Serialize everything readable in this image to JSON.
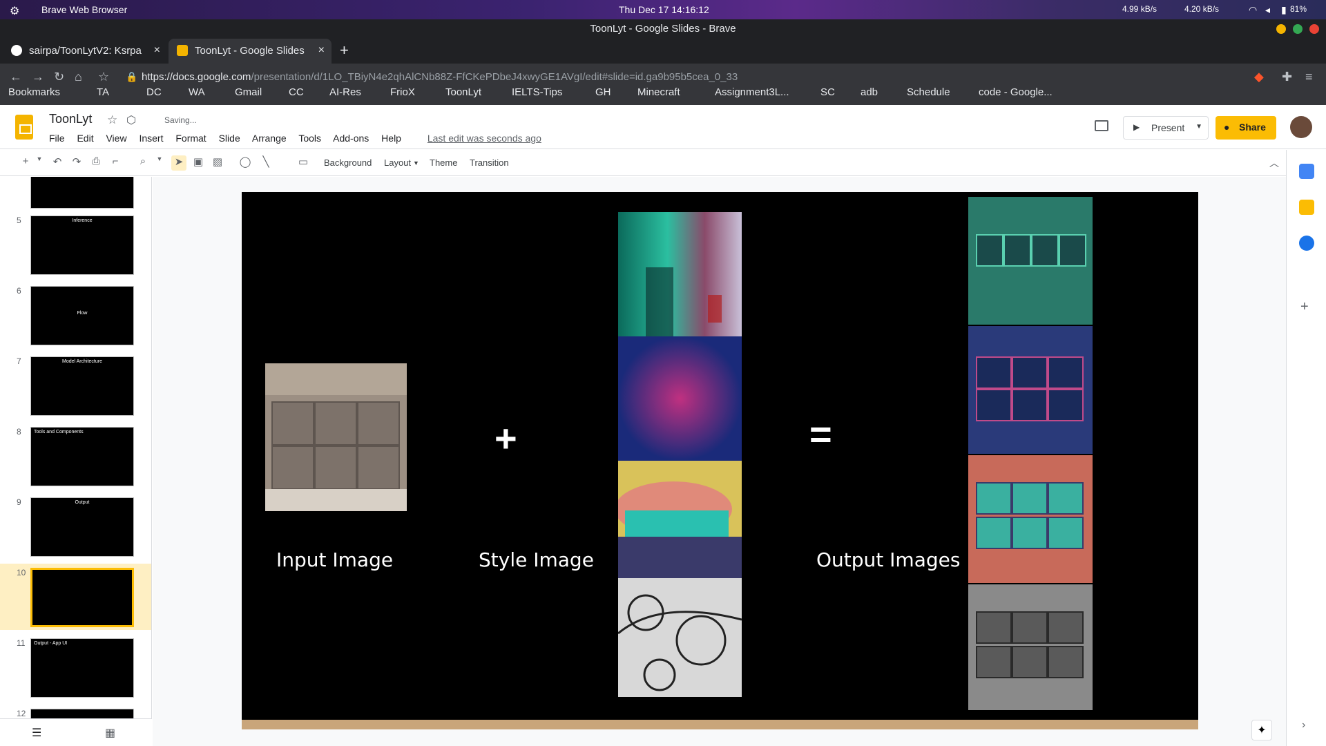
{
  "os_bar": {
    "app": "Brave Web Browser",
    "datetime": "Thu Dec 17  14:16:12",
    "upload": "4.99 kB/s",
    "download": "4.20 kB/s",
    "battery": "81%"
  },
  "window_title": "ToonLyt - Google Slides - Brave",
  "tabs": [
    {
      "label": "sairpa/ToonLytV2: Ksrpa",
      "close": "×"
    },
    {
      "label": "ToonLyt - Google Slides",
      "close": "×"
    }
  ],
  "new_tab": "+",
  "url": {
    "prefix": "https://",
    "domain": "docs.google.com",
    "path": "/presentation/d/1LO_TBiyN4e2qhAlCNb88Z-FfCKePDbeJ4xwyGE1AVgI/edit#slide=id.ga9b95b5cea_0_33"
  },
  "bookmarks": [
    "Bookmarks",
    "TA",
    "DC",
    "WA",
    "Gmail",
    "CC",
    "AI-Res",
    "FrioX",
    "ToonLyt",
    "IELTS-Tips",
    "GH",
    "Minecraft",
    "Assignment3L...",
    "SC",
    "adb",
    "Schedule",
    "code - Google..."
  ],
  "doc": {
    "title": "ToonLyt",
    "saving": "Saving...",
    "last_edit": "Last edit was seconds ago"
  },
  "menu": [
    "File",
    "Edit",
    "View",
    "Insert",
    "Format",
    "Slide",
    "Arrange",
    "Tools",
    "Add-ons",
    "Help"
  ],
  "header_buttons": {
    "present": "Present",
    "share": "Share"
  },
  "toolbar": {
    "background": "Background",
    "layout": "Layout",
    "theme": "Theme",
    "transition": "Transition"
  },
  "slides": [
    {
      "num": "5",
      "title": "Inference"
    },
    {
      "num": "6",
      "title": "Flow"
    },
    {
      "num": "7",
      "title": "Model Architecture"
    },
    {
      "num": "8",
      "title": "Tools and Components"
    },
    {
      "num": "9",
      "title": "Output"
    },
    {
      "num": "10",
      "title": ""
    },
    {
      "num": "11",
      "title": "Output - App UI"
    },
    {
      "num": "12",
      "title": ""
    }
  ],
  "current_slide": {
    "input_label": "Input Image",
    "style_label": "Style Image",
    "output_label": "Output Images",
    "plus": "+",
    "equals": "="
  }
}
